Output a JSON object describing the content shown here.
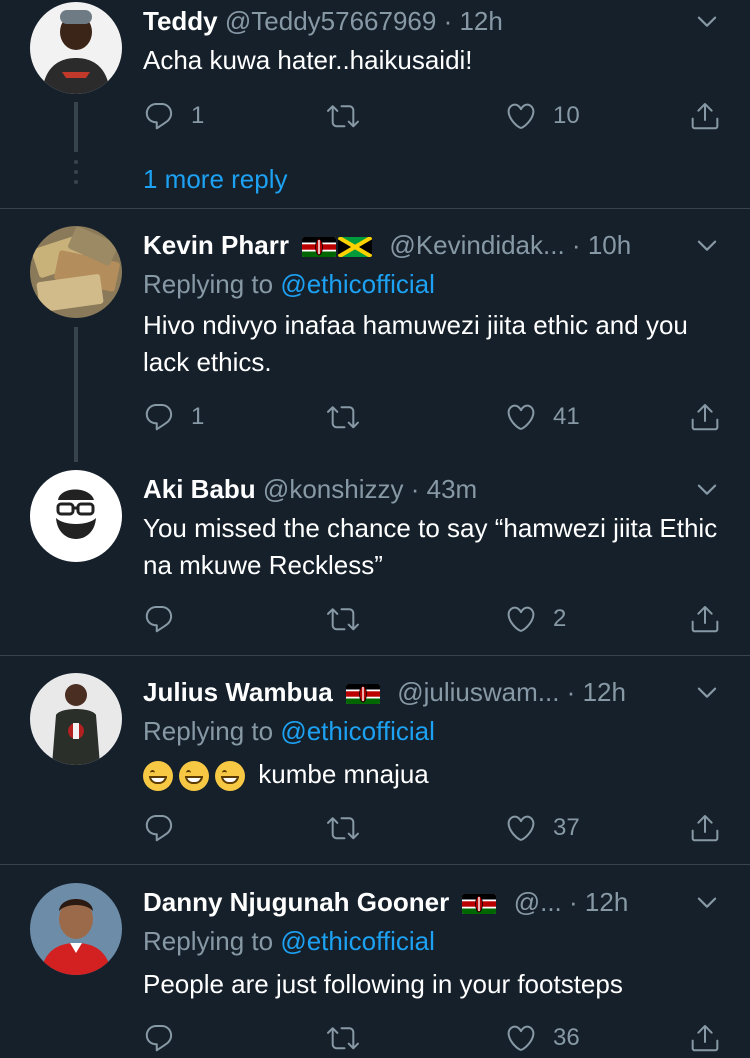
{
  "tweets": [
    {
      "name": "Teddy",
      "handle": "@Teddy57667969",
      "sep": "·",
      "time": "12h",
      "text": "Acha kuwa hater..haikusaidi!",
      "replies": "1",
      "retweets": "",
      "likes": "10",
      "more_replies": "1 more reply"
    },
    {
      "name": "Kevin Pharr",
      "flags": [
        "kenya-flag",
        "jamaica-flag"
      ],
      "handle": "@Kevindidak...",
      "sep": "·",
      "time": "10h",
      "replying_prefix": "Replying to",
      "replying_to": "@ethicofficial",
      "text": "Hivo ndivyo inafaa hamuwezi jiita ethic and you lack ethics.",
      "replies": "1",
      "retweets": "",
      "likes": "41"
    },
    {
      "name": "Aki Babu",
      "handle": "@konshizzy",
      "sep": "·",
      "time": "43m",
      "text": "You missed the chance to say “hamwezi jiita Ethic na mkuwe Reckless”",
      "replies": "",
      "retweets": "",
      "likes": "2"
    },
    {
      "name": "Julius Wambua",
      "flags": [
        "kenya-flag"
      ],
      "handle": "@juliuswam...",
      "sep": "·",
      "time": "12h",
      "replying_prefix": "Replying to",
      "replying_to": "@ethicofficial",
      "emojis": [
        "grinning-emoji",
        "grinning-emoji",
        "grinning-emoji"
      ],
      "text": "kumbe mnajua",
      "replies": "",
      "retweets": "",
      "likes": "37"
    },
    {
      "name": "Danny Njugunah Gooner",
      "flags": [
        "kenya-flag"
      ],
      "handle": "@...",
      "sep": "·",
      "time": "12h",
      "replying_prefix": "Replying to",
      "replying_to": "@ethicofficial",
      "text": "People are just following in your footsteps",
      "replies": "",
      "retweets": "",
      "likes": "36"
    }
  ],
  "colors": {
    "background": "#15202b",
    "secondary_text": "#8899a6",
    "accent": "#1da1f2",
    "divider": "#38444d"
  }
}
